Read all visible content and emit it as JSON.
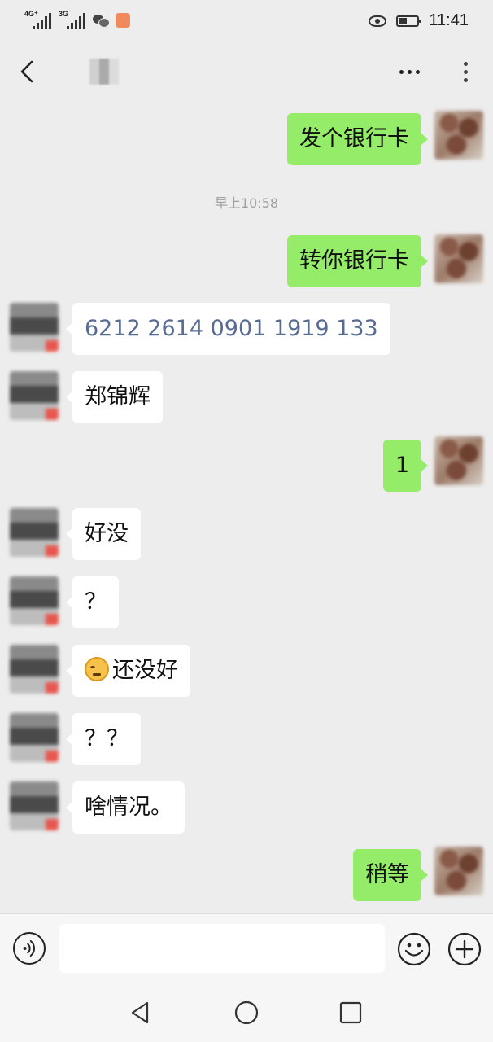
{
  "status_bar": {
    "network1": "4G⁺",
    "network2": "3G",
    "time": "11:41"
  },
  "messages": [
    {
      "from": "me",
      "text": "发个银行卡"
    },
    {
      "from": "system",
      "text": "早上10:58"
    },
    {
      "from": "me",
      "text": "转你银行卡"
    },
    {
      "from": "other",
      "text": "6212 2614 0901 1919 133"
    },
    {
      "from": "other",
      "text": "郑锦辉"
    },
    {
      "from": "me",
      "text": "1"
    },
    {
      "from": "other",
      "text": "好没"
    },
    {
      "from": "other",
      "text": "？"
    },
    {
      "from": "other",
      "text": "还没好",
      "emoji": "sweat-face-icon"
    },
    {
      "from": "other",
      "text": "？？"
    },
    {
      "from": "other",
      "text": "啥情况。"
    },
    {
      "from": "me",
      "text": "稍等"
    }
  ],
  "colors": {
    "my_bubble": "#95ec69",
    "other_bubble": "#ffffff",
    "background": "#ededed",
    "card_text": "#576b95"
  },
  "icons": {
    "back": "back-chevron-icon",
    "more": "more-dots-icon",
    "voice": "voice-icon",
    "emoji": "smile-icon",
    "plus": "plus-icon"
  },
  "input": {
    "value": ""
  }
}
